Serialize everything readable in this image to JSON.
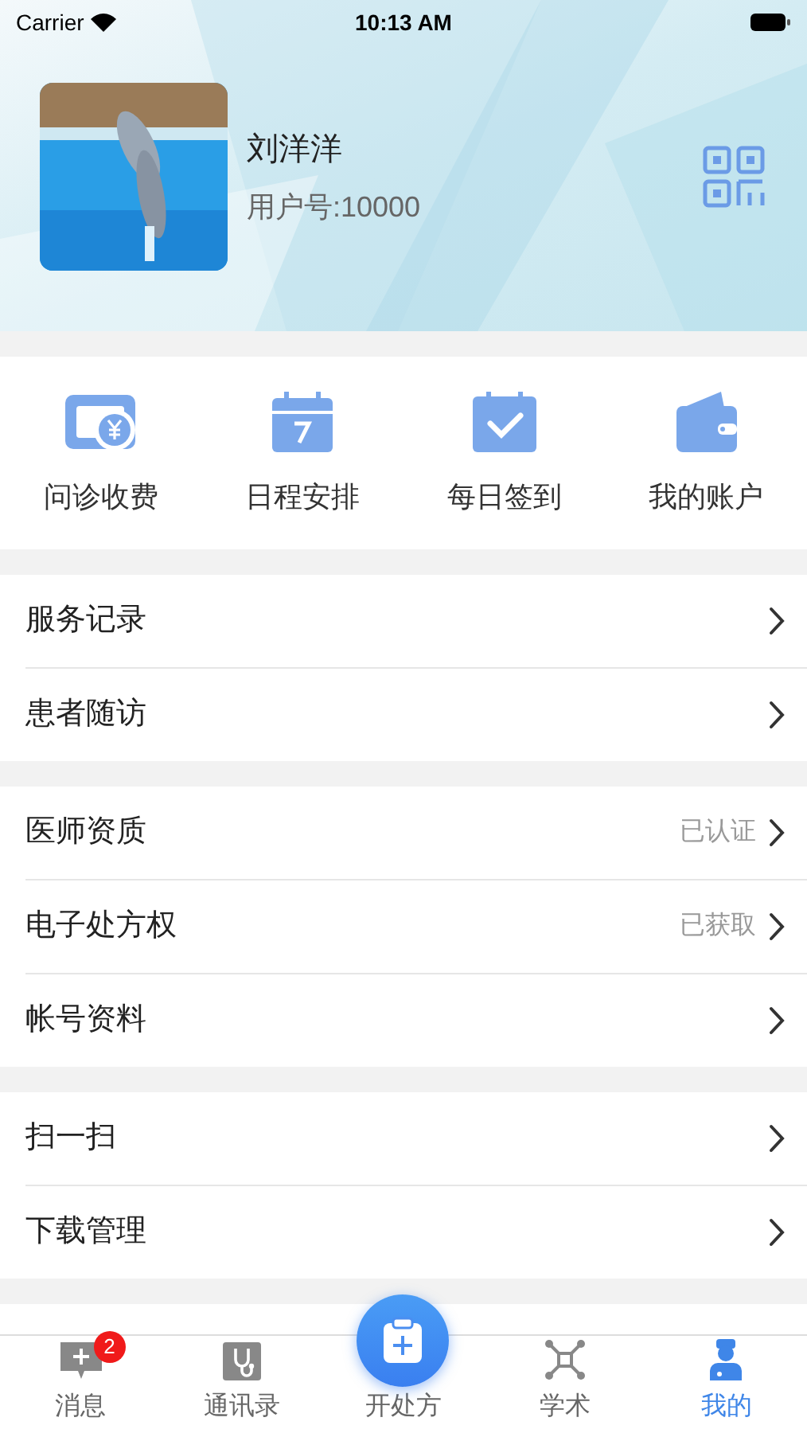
{
  "status_bar": {
    "carrier": "Carrier",
    "time": "10:13 AM"
  },
  "profile": {
    "name": "刘洋洋",
    "user_id": "用户号:10000"
  },
  "quick_actions": [
    {
      "label": "问诊收费"
    },
    {
      "label": "日程安排"
    },
    {
      "label": "每日签到"
    },
    {
      "label": "我的账户"
    }
  ],
  "menu_groups": [
    {
      "items": [
        {
          "label": "服务记录"
        },
        {
          "label": "患者随访"
        }
      ]
    },
    {
      "items": [
        {
          "label": "医师资质",
          "status": "已认证"
        },
        {
          "label": "电子处方权",
          "status": "已获取"
        },
        {
          "label": "帐号资料"
        }
      ]
    },
    {
      "items": [
        {
          "label": "扫一扫"
        },
        {
          "label": "下载管理"
        }
      ]
    }
  ],
  "tab_bar": [
    {
      "label": "消息",
      "badge": "2",
      "selected": false,
      "kind": "normal"
    },
    {
      "label": "通讯录",
      "selected": false,
      "kind": "normal"
    },
    {
      "label": "开处方",
      "selected": false,
      "kind": "raised"
    },
    {
      "label": "学术",
      "selected": false,
      "kind": "normal"
    },
    {
      "label": "我的",
      "selected": true,
      "kind": "normal"
    }
  ]
}
